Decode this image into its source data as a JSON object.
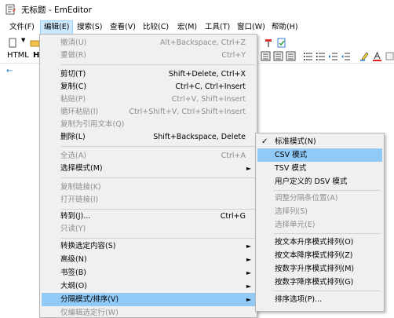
{
  "window": {
    "title": "无标题 - EmEditor"
  },
  "menubar": [
    {
      "label": "文件(F)"
    },
    {
      "label": "编辑(E)"
    },
    {
      "label": "搜索(S)"
    },
    {
      "label": "查看(V)"
    },
    {
      "label": "比较(C)"
    },
    {
      "label": "宏(M)"
    },
    {
      "label": "工具(T)"
    },
    {
      "label": "窗口(W)"
    },
    {
      "label": "帮助(H)"
    }
  ],
  "toolbar2": {
    "html_label": "HTML",
    "h_label": "H"
  },
  "edit_menu": {
    "items": [
      {
        "label": "撤消(U)",
        "key": "Alt+Backspace, Ctrl+Z"
      },
      {
        "label": "重做(R)",
        "key": "Ctrl+Y"
      },
      {
        "label": "剪切(T)",
        "key": "Shift+Delete, Ctrl+X"
      },
      {
        "label": "复制(C)",
        "key": "Ctrl+C, Ctrl+Insert"
      },
      {
        "label": "粘贴(P)",
        "key": "Ctrl+V, Shift+Insert"
      },
      {
        "label": "循环粘贴(I)",
        "key": "Ctrl+Shift+V, Ctrl+Shift+Insert"
      },
      {
        "label": "复制为引用文本(Q)",
        "key": ""
      },
      {
        "label": "删除(L)",
        "key": "Shift+Backspace, Delete"
      },
      {
        "label": "全选(A)",
        "key": "Ctrl+A"
      },
      {
        "label": "选择模式(M)",
        "key": ""
      },
      {
        "label": "复制链接(K)",
        "key": ""
      },
      {
        "label": "打开链接(I)",
        "key": ""
      },
      {
        "label": "转到(J)...",
        "key": "Ctrl+G"
      },
      {
        "label": "只读(Y)",
        "key": ""
      },
      {
        "label": "转换选定内容(S)",
        "key": ""
      },
      {
        "label": "高级(N)",
        "key": ""
      },
      {
        "label": "书签(B)",
        "key": ""
      },
      {
        "label": "大纲(O)",
        "key": ""
      },
      {
        "label": "分隔模式/排序(V)",
        "key": ""
      },
      {
        "label": "仅编辑选定行(W)",
        "key": ""
      }
    ]
  },
  "separator_submenu": {
    "items": [
      {
        "label": "标准模式(N)",
        "checked": true
      },
      {
        "label": "CSV 模式"
      },
      {
        "label": "TSV 模式"
      },
      {
        "label": "用户定义的 DSV 模式"
      },
      {
        "label": "调整分隔条位置(A)"
      },
      {
        "label": "选择列(S)"
      },
      {
        "label": "选择单元(E)"
      },
      {
        "label": "按文本升序模式排列(O)"
      },
      {
        "label": "按文本降序模式排列(Z)"
      },
      {
        "label": "按数字升序模式排列(M)"
      },
      {
        "label": "按数字降序模式排列(G)"
      },
      {
        "label": "排序选项(P)..."
      }
    ],
    "check_glyph": "✓"
  },
  "colors": {
    "highlight": "#91c9f7",
    "menu_bg": "#f0f0f0",
    "active_menu": "#cce8ff"
  },
  "icons": {
    "app": "emeditor-notepad-icon",
    "arrow": "left-arrow-caret"
  }
}
